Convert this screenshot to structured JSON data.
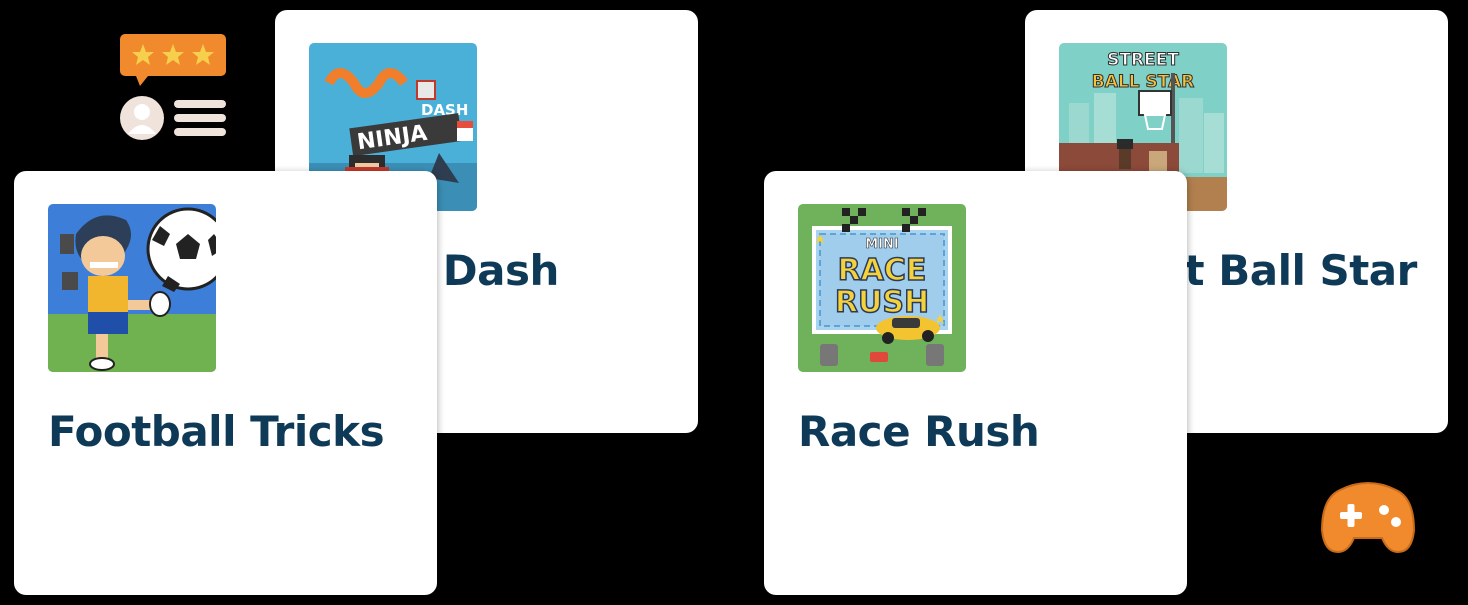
{
  "games": {
    "ninja": {
      "title": "Ninja Dash",
      "thumb_text_1": "DASH",
      "thumb_text_2": "NINJA"
    },
    "football": {
      "title": "Football Tricks"
    },
    "street": {
      "title": "Street Ball Star",
      "thumb_text_1": "STREET",
      "thumb_text_2": "BALL STAR"
    },
    "race": {
      "title": "Race Rush",
      "thumb_text_1": "MINI",
      "thumb_text_2": "RACE",
      "thumb_text_3": "RUSH"
    }
  },
  "rating": {
    "stars": 3
  },
  "colors": {
    "title": "#0f3a57",
    "accent": "#f08a2c",
    "card_bg": "#ffffff",
    "page_bg": "#000000",
    "avatar_bg": "#efe3dc"
  },
  "icons": [
    "star-icon",
    "user-avatar-icon",
    "list-lines-icon",
    "gamepad-icon"
  ]
}
